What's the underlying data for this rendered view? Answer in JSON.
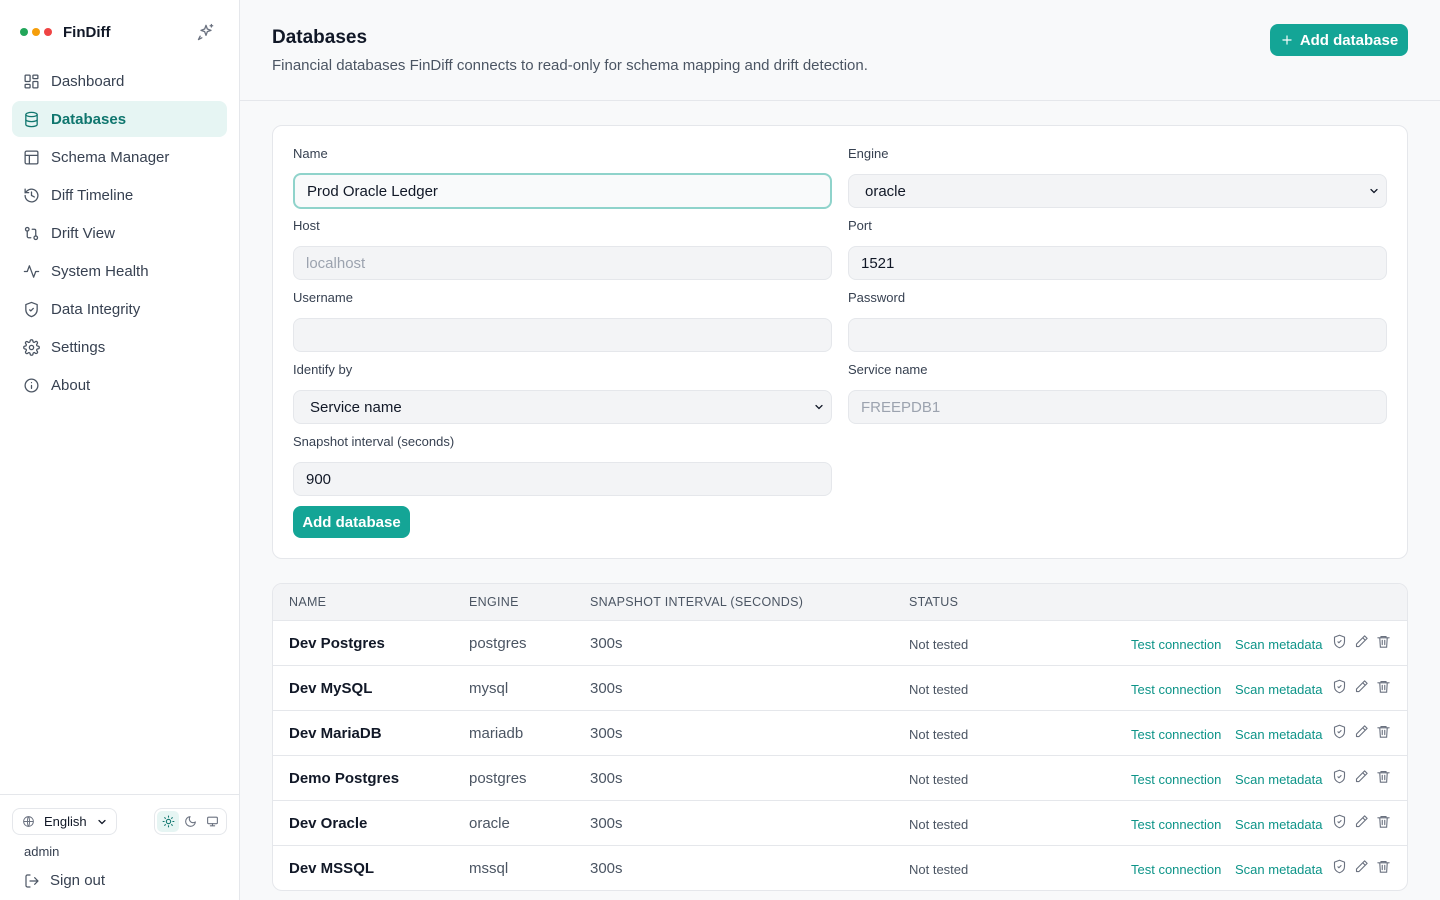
{
  "app": {
    "name": "FinDiff",
    "dot_colors": [
      "#22a65a",
      "#f59e0b",
      "#ef4444"
    ]
  },
  "sidebar": {
    "items": [
      {
        "label": "Dashboard",
        "icon": "dashboard-icon"
      },
      {
        "label": "Databases",
        "icon": "database-icon",
        "active": true
      },
      {
        "label": "Schema Manager",
        "icon": "table-icon"
      },
      {
        "label": "Diff Timeline",
        "icon": "history-icon"
      },
      {
        "label": "Drift View",
        "icon": "git-compare-icon"
      },
      {
        "label": "System Health",
        "icon": "activity-icon"
      },
      {
        "label": "Data Integrity",
        "icon": "shield-check-icon"
      },
      {
        "label": "Settings",
        "icon": "gear-icon"
      },
      {
        "label": "About",
        "icon": "info-icon"
      }
    ],
    "language": "English",
    "user": "admin",
    "sign_out": "Sign out"
  },
  "header": {
    "title": "Databases",
    "subtitle": "Financial databases FinDiff connects to read-only for schema mapping and drift detection.",
    "add_button": "Add database"
  },
  "form": {
    "name": {
      "label": "Name",
      "value": "Prod Oracle Ledger"
    },
    "engine": {
      "label": "Engine",
      "value": "oracle"
    },
    "host": {
      "label": "Host",
      "placeholder": "localhost"
    },
    "port": {
      "label": "Port",
      "value": "1521"
    },
    "username": {
      "label": "Username",
      "value": ""
    },
    "password": {
      "label": "Password",
      "value": ""
    },
    "identify_by": {
      "label": "Identify by",
      "value": "Service name"
    },
    "service_name": {
      "label": "Service name",
      "placeholder": "FREEPDB1"
    },
    "snapshot_interval": {
      "label": "Snapshot interval (seconds)",
      "value": "900"
    },
    "submit": "Add database"
  },
  "table": {
    "headers": [
      "NAME",
      "ENGINE",
      "SNAPSHOT INTERVAL (SECONDS)",
      "STATUS"
    ],
    "action_labels": {
      "test": "Test connection",
      "scan": "Scan metadata"
    },
    "rows": [
      {
        "name": "Dev Postgres",
        "engine": "postgres",
        "interval": "300s",
        "status": "Not tested"
      },
      {
        "name": "Dev MySQL",
        "engine": "mysql",
        "interval": "300s",
        "status": "Not tested"
      },
      {
        "name": "Dev MariaDB",
        "engine": "mariadb",
        "interval": "300s",
        "status": "Not tested"
      },
      {
        "name": "Demo Postgres",
        "engine": "postgres",
        "interval": "300s",
        "status": "Not tested"
      },
      {
        "name": "Dev Oracle",
        "engine": "oracle",
        "interval": "300s",
        "status": "Not tested"
      },
      {
        "name": "Dev MSSQL",
        "engine": "mssql",
        "interval": "300s",
        "status": "Not tested"
      }
    ]
  },
  "colors": {
    "accent": "#14a596",
    "accent_text": "#0d9488",
    "active_bg": "#e6f5f3"
  }
}
